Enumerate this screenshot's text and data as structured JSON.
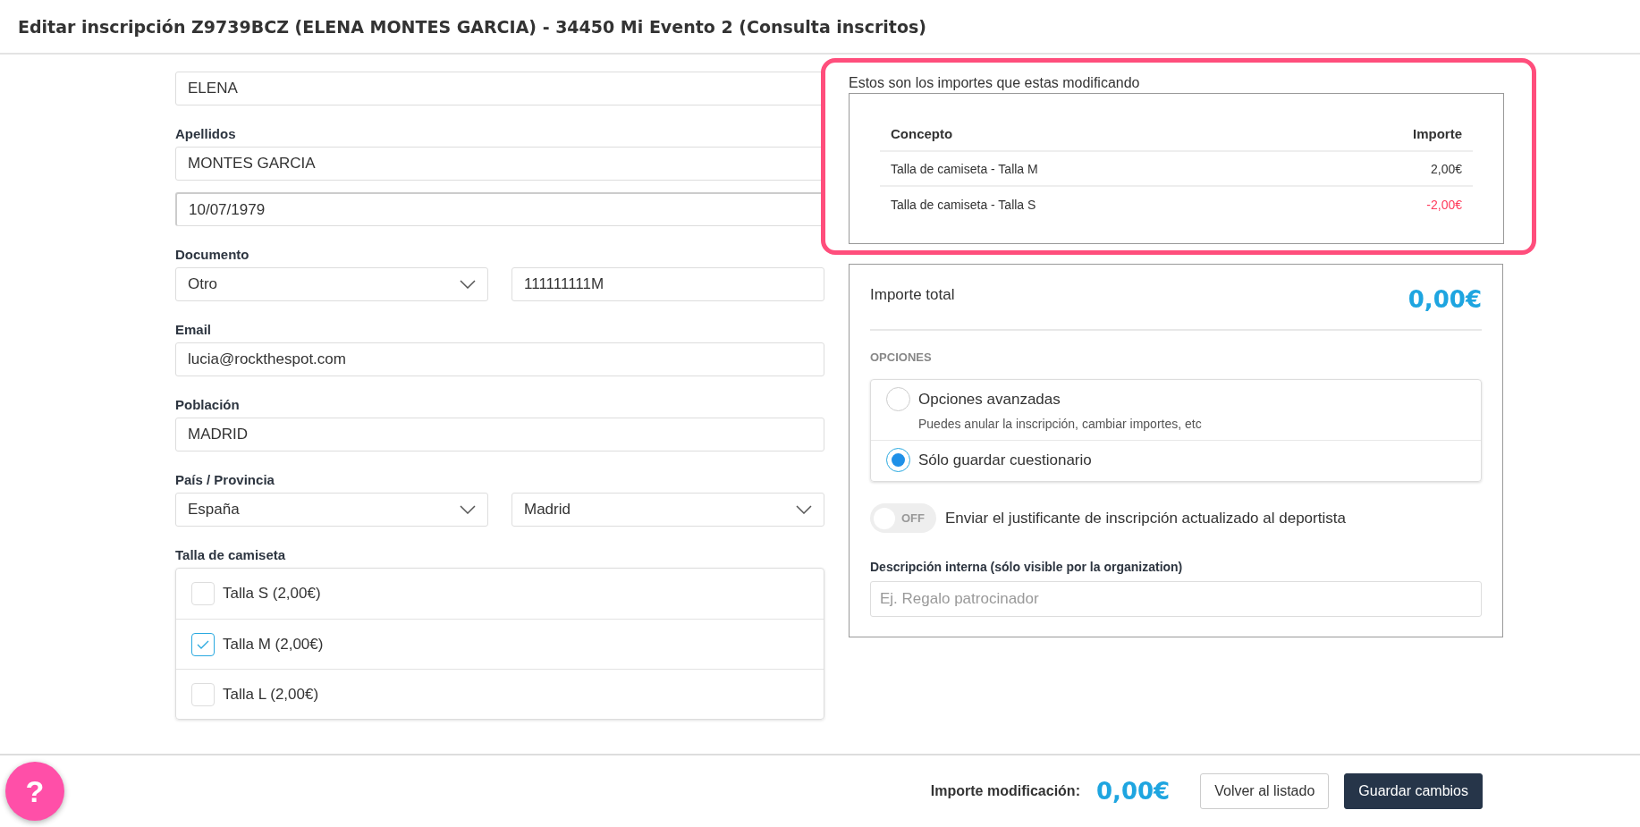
{
  "header": {
    "title": "Editar inscripción Z9739BCZ (ELENA MONTES GARCIA) - 34450 Mi Evento 2 (Consulta inscritos)"
  },
  "form": {
    "rows": [
      {
        "controls": [
          {
            "kind": "input",
            "value": "ELENA"
          }
        ]
      },
      {
        "label": "Apellidos",
        "controls": [
          {
            "kind": "input",
            "value": "MONTES GARCIA"
          }
        ]
      },
      {
        "controls": [
          {
            "kind": "date",
            "value": "10/07/1979"
          }
        ]
      },
      {
        "label": "Documento",
        "controls": [
          {
            "kind": "select",
            "value": "Otro"
          },
          {
            "kind": "input",
            "value": "111111111M"
          }
        ]
      },
      {
        "label": "Email",
        "controls": [
          {
            "kind": "input",
            "value": "lucia@rockthespot.com"
          }
        ]
      },
      {
        "label": "Población",
        "controls": [
          {
            "kind": "input",
            "value": "MADRID"
          }
        ]
      },
      {
        "label": "País / Provincia",
        "controls": [
          {
            "kind": "select",
            "value": "España"
          },
          {
            "kind": "select",
            "value": "Madrid"
          }
        ]
      }
    ],
    "tshirt": {
      "label": "Talla de camiseta",
      "options": [
        {
          "label": "Talla S (2,00€)",
          "checked": false
        },
        {
          "label": "Talla M (2,00€)",
          "checked": true
        },
        {
          "label": "Talla L (2,00€)",
          "checked": false
        }
      ]
    }
  },
  "summary": {
    "title": "Estos son los importes que estas modificando",
    "columns": [
      "Concepto",
      "Importe"
    ],
    "rows": [
      {
        "concept": "Talla de camiseta - Talla M",
        "amount": "2,00€",
        "negative": false
      },
      {
        "concept": "Talla de camiseta - Talla S",
        "amount": "-2,00€",
        "negative": true
      }
    ]
  },
  "panel": {
    "total_label": "Importe total",
    "total_value": "0,00€",
    "options_title": "OPCIONES",
    "options": [
      {
        "label": "Opciones avanzadas",
        "description": "Puedes anular la inscripción, cambiar importes, etc",
        "selected": false
      },
      {
        "label": "Sólo guardar cuestionario",
        "selected": true
      }
    ],
    "notify": {
      "on": false,
      "state_text": "OFF",
      "label": "Enviar el justificante de inscripción actualizado al deportista"
    },
    "note": {
      "label": "Descripción interna (sólo visible por la organization)",
      "placeholder": "Ej. Regalo patrocinador"
    }
  },
  "footer": {
    "help": "?",
    "label": "Importe modificación:",
    "value": "0,00€",
    "buttons": [
      {
        "label": "Volver al listado",
        "kind": "secondary"
      },
      {
        "label": "Guardar cambios",
        "kind": "primary"
      }
    ]
  }
}
